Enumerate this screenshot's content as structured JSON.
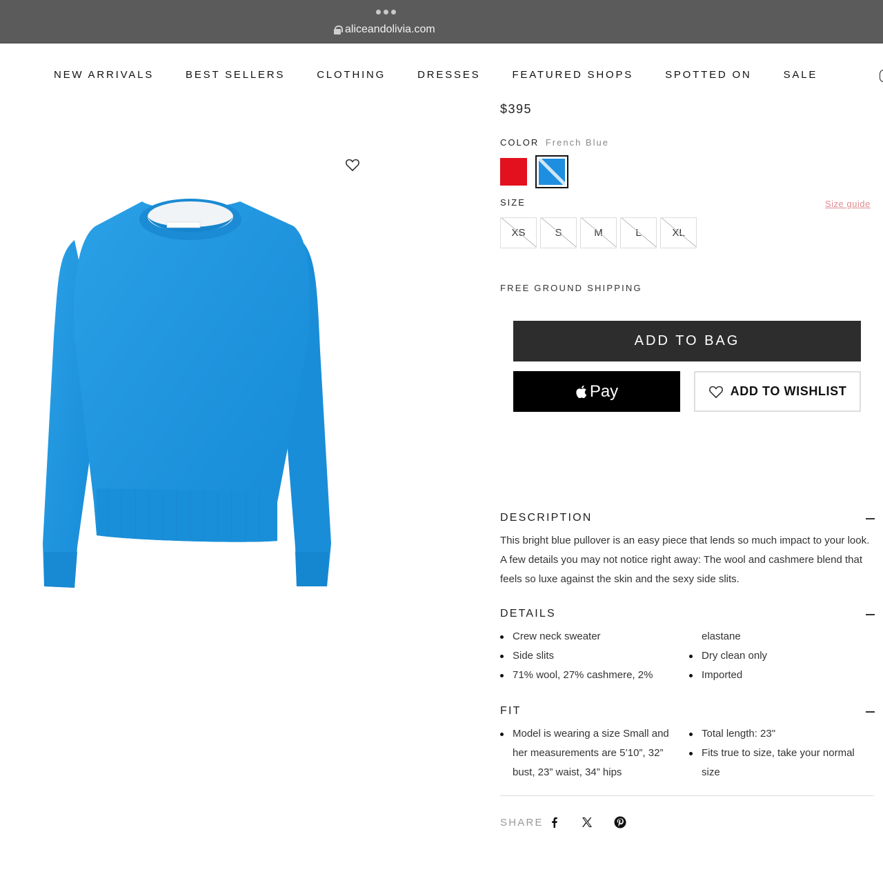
{
  "browser": {
    "url": "aliceandolivia.com"
  },
  "nav": {
    "items": [
      "NEW ARRIVALS",
      "BEST SELLERS",
      "CLOTHING",
      "DRESSES",
      "FEATURED SHOPS",
      "SPOTTED ON",
      "SALE"
    ]
  },
  "product": {
    "price": "$395",
    "color_label": "COLOR",
    "color_value": "French Blue",
    "swatches": [
      {
        "name": "red",
        "color": "#e3101e",
        "selected": false
      },
      {
        "name": "French Blue",
        "color": "#1e8fe0",
        "selected": true
      }
    ],
    "size_label": "SIZE",
    "size_guide": "Size guide",
    "sizes": [
      "XS",
      "S",
      "M",
      "L",
      "XL"
    ],
    "shipping": "FREE GROUND SHIPPING",
    "add_to_bag": "ADD TO BAG",
    "apple_pay": "Pay",
    "add_to_wishlist": "ADD TO WISHLIST"
  },
  "description": {
    "title": "DESCRIPTION",
    "text": "This bright blue pullover is an easy piece that lends so much impact to your look. A few details you may not notice right away: The wool and cashmere blend that feels so luxe against the skin and the sexy side slits."
  },
  "details": {
    "title": "DETAILS",
    "left": [
      "Crew neck sweater",
      "Side slits",
      "71% wool, 27% cashmere, 2%"
    ],
    "right_continuation": "elastane",
    "right": [
      "Dry clean only",
      "Imported"
    ]
  },
  "fit": {
    "title": "FIT",
    "left": [
      "Model is wearing a size Small and her measurements are 5’10”, 32” bust, 23” waist, 34” hips"
    ],
    "right": [
      "Total length: 23\"",
      "Fits true to size, take your normal size"
    ]
  },
  "share": {
    "label": "SHARE",
    "icons": [
      "facebook-icon",
      "x-icon",
      "pinterest-icon"
    ]
  },
  "colors": {
    "accent_link": "#e08a92",
    "button_dark": "#2d2d2d",
    "sweater_blue": "#1b93dc"
  }
}
